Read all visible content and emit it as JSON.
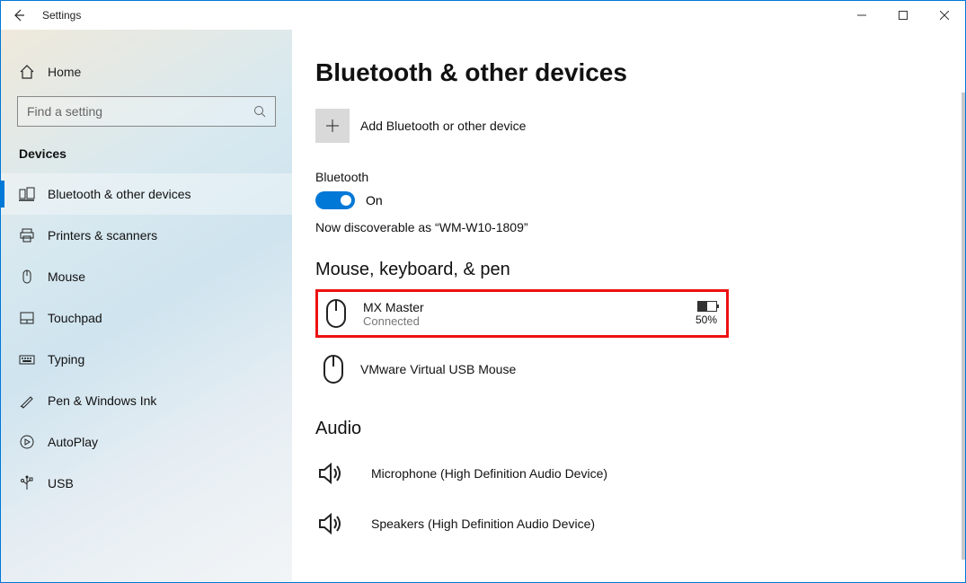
{
  "window": {
    "title": "Settings"
  },
  "sidebar": {
    "home_label": "Home",
    "search_placeholder": "Find a setting",
    "category_label": "Devices",
    "items": [
      {
        "label": "Bluetooth & other devices",
        "selected": true
      },
      {
        "label": "Printers & scanners"
      },
      {
        "label": "Mouse"
      },
      {
        "label": "Touchpad"
      },
      {
        "label": "Typing"
      },
      {
        "label": "Pen & Windows Ink"
      },
      {
        "label": "AutoPlay"
      },
      {
        "label": "USB"
      }
    ]
  },
  "page": {
    "heading": "Bluetooth & other devices",
    "add_button_label": "Add Bluetooth or other device",
    "bluetooth_section_label": "Bluetooth",
    "bluetooth_toggle_state_label": "On",
    "bluetooth_on": true,
    "discoverable_text": "Now discoverable as “WM-W10-1809”",
    "mouse_section_heading": "Mouse, keyboard, & pen",
    "devices": [
      {
        "name": "MX Master",
        "status": "Connected",
        "battery_percent": "50%",
        "highlighted": true
      },
      {
        "name": "VMware Virtual USB Mouse",
        "status": "",
        "highlighted": false
      }
    ],
    "audio_section_heading": "Audio",
    "audio_devices": [
      {
        "name": "Microphone (High Definition Audio Device)"
      },
      {
        "name": "Speakers (High Definition Audio Device)"
      }
    ]
  }
}
